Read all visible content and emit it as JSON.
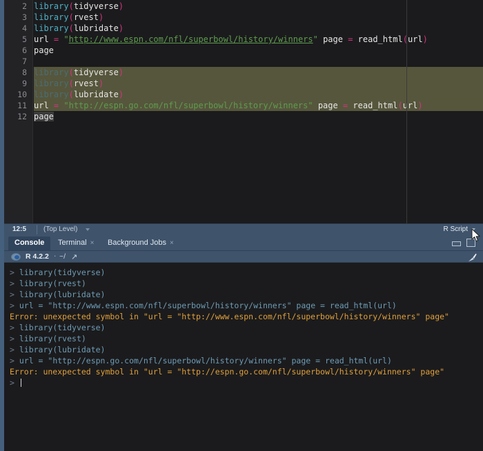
{
  "editor": {
    "name": "source-editor",
    "margin_column_x": 583,
    "lines": [
      {
        "num": "2",
        "selected": false,
        "tokens": [
          {
            "t": "library",
            "c": "t-fn"
          },
          {
            "t": "(",
            "c": "t-paren"
          },
          {
            "t": "tidyverse",
            "c": "t-id"
          },
          {
            "t": ")",
            "c": "t-paren"
          }
        ]
      },
      {
        "num": "3",
        "selected": false,
        "tokens": [
          {
            "t": "library",
            "c": "t-fn"
          },
          {
            "t": "(",
            "c": "t-paren"
          },
          {
            "t": "rvest",
            "c": "t-id"
          },
          {
            "t": ")",
            "c": "t-paren"
          }
        ]
      },
      {
        "num": "4",
        "selected": false,
        "tokens": [
          {
            "t": "library",
            "c": "t-fn"
          },
          {
            "t": "(",
            "c": "t-paren"
          },
          {
            "t": "lubridate",
            "c": "t-id"
          },
          {
            "t": ")",
            "c": "t-paren"
          }
        ]
      },
      {
        "num": "5",
        "selected": false,
        "tokens": [
          {
            "t": "url ",
            "c": "t-plain"
          },
          {
            "t": "=",
            "c": "t-op"
          },
          {
            "t": " ",
            "c": "t-plain"
          },
          {
            "t": "\"",
            "c": "t-str"
          },
          {
            "t": "http://www.espn.com/nfl/superbowl/history/winners",
            "c": "t-str-u"
          },
          {
            "t": "\"",
            "c": "t-str"
          },
          {
            "t": " page ",
            "c": "t-plain"
          },
          {
            "t": "=",
            "c": "t-op"
          },
          {
            "t": " read_html",
            "c": "t-plain"
          },
          {
            "t": "(",
            "c": "t-paren"
          },
          {
            "t": "url",
            "c": "t-plain"
          },
          {
            "t": ")",
            "c": "t-paren"
          }
        ]
      },
      {
        "num": "6",
        "selected": false,
        "tokens": [
          {
            "t": "page",
            "c": "t-plain"
          }
        ]
      },
      {
        "num": "7",
        "selected": false,
        "tokens": []
      },
      {
        "num": "8",
        "selected": true,
        "tokens": [
          {
            "t": "library",
            "c": "t-fn-dim"
          },
          {
            "t": "(",
            "c": "t-paren"
          },
          {
            "t": "tidyverse",
            "c": "t-id"
          },
          {
            "t": ")",
            "c": "t-paren"
          }
        ]
      },
      {
        "num": "9",
        "selected": true,
        "tokens": [
          {
            "t": "library",
            "c": "t-fn-dim"
          },
          {
            "t": "(",
            "c": "t-paren"
          },
          {
            "t": "rvest",
            "c": "t-id"
          },
          {
            "t": ")",
            "c": "t-paren"
          }
        ]
      },
      {
        "num": "10",
        "selected": true,
        "tokens": [
          {
            "t": "library",
            "c": "t-fn-dim"
          },
          {
            "t": "(",
            "c": "t-paren"
          },
          {
            "t": "lubridate",
            "c": "t-id"
          },
          {
            "t": ")",
            "c": "t-paren"
          }
        ]
      },
      {
        "num": "11",
        "selected": true,
        "tokens": [
          {
            "t": "url ",
            "c": "t-plain"
          },
          {
            "t": "=",
            "c": "t-op"
          },
          {
            "t": " ",
            "c": "t-plain"
          },
          {
            "t": "\"http://espn.go.com/nfl/superbowl/history/winners\"",
            "c": "t-str"
          },
          {
            "t": " page ",
            "c": "t-plain"
          },
          {
            "t": "=",
            "c": "t-op"
          },
          {
            "t": " read_html",
            "c": "t-plain"
          },
          {
            "t": "(",
            "c": "t-paren"
          },
          {
            "t": "url",
            "c": "t-plain"
          },
          {
            "t": ")",
            "c": "t-paren"
          }
        ]
      },
      {
        "num": "12",
        "selected": false,
        "word_highlight": true,
        "tokens": [
          {
            "t": "page",
            "c": "t-plain"
          }
        ]
      }
    ]
  },
  "editor_status": {
    "cursor_position": "12:5",
    "scope": "(Top Level)",
    "file_type": "R Script"
  },
  "console": {
    "tabs": [
      {
        "label": "Console",
        "active": true,
        "closable": false
      },
      {
        "label": "Terminal",
        "active": false,
        "closable": true,
        "close": "×"
      },
      {
        "label": "Background Jobs",
        "active": false,
        "closable": true,
        "close": "×"
      }
    ],
    "panel_buttons": {
      "minimize": "minimize",
      "maximize": "maximize"
    },
    "info": {
      "r_version": "R 4.2.2",
      "separator": "·",
      "working_directory": "~/",
      "wd_arrow": "↗",
      "clear_icon": "broom-icon"
    },
    "output": [
      {
        "type": "cmd",
        "prompt": "> ",
        "text": "library(tidyverse)"
      },
      {
        "type": "cmd",
        "prompt": "> ",
        "text": "library(rvest)"
      },
      {
        "type": "cmd",
        "prompt": "> ",
        "text": "library(lubridate)"
      },
      {
        "type": "cmd",
        "prompt": "> ",
        "text": "url = \"http://www.espn.com/nfl/superbowl/history/winners\" page = read_html(url)"
      },
      {
        "type": "err",
        "prompt": "",
        "text": "Error: unexpected symbol in \"url = \"http://www.espn.com/nfl/superbowl/history/winners\" page\""
      },
      {
        "type": "cmd",
        "prompt": "> ",
        "text": "library(tidyverse)"
      },
      {
        "type": "cmd",
        "prompt": "> ",
        "text": "library(rvest)"
      },
      {
        "type": "cmd",
        "prompt": "> ",
        "text": "library(lubridate)"
      },
      {
        "type": "cmd",
        "prompt": "> ",
        "text": "url = \"http://espn.go.com/nfl/superbowl/history/winners\" page = read_html(url)"
      },
      {
        "type": "err",
        "prompt": "",
        "text": "Error: unexpected symbol in \"url = \"http://espn.go.com/nfl/superbowl/history/winners\" page\""
      },
      {
        "type": "prompt",
        "prompt": "> ",
        "text": "",
        "caret": true
      }
    ]
  },
  "colors": {
    "editor_bg": "#1b1b1d",
    "gutter_bg": "#232326",
    "selection": "#56563c",
    "chrome": "#3f536b",
    "function": "#4fb0c6",
    "paren": "#d1367f",
    "string": "#5e9c4e",
    "console_cmd": "#6e9cb5",
    "console_error": "#e0a03a"
  }
}
